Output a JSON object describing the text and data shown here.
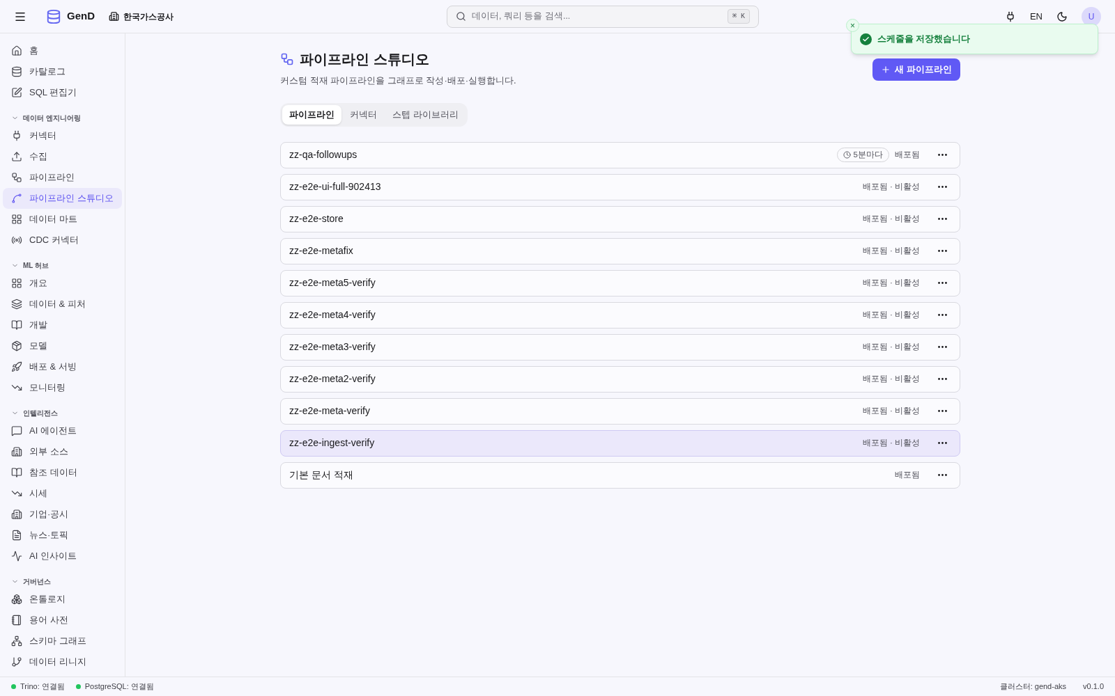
{
  "header": {
    "brand": "GenD",
    "org": "한국가스공사",
    "search": {
      "placeholder": "데이터, 쿼리 등을 검색...",
      "shortcut": "⌘ K"
    },
    "language": "EN",
    "avatar": "U"
  },
  "toast": {
    "message": "스케줄을 저장했습니다",
    "close": "×"
  },
  "sidebar": {
    "top_items": [
      {
        "label": "홈",
        "selected": false
      },
      {
        "label": "카탈로그",
        "selected": false
      },
      {
        "label": "SQL 편집기",
        "selected": false
      }
    ],
    "sections": [
      {
        "title": "데이터 엔지니어링",
        "expanded": true,
        "items": [
          {
            "label": "커넥터",
            "selected": false
          },
          {
            "label": "수집",
            "selected": false
          },
          {
            "label": "파이프라인",
            "selected": false
          },
          {
            "label": "파이프라인 스튜디오",
            "selected": true
          },
          {
            "label": "데이터 마트",
            "selected": false
          },
          {
            "label": "CDC 커넥터",
            "selected": false
          }
        ]
      },
      {
        "title": "ML 허브",
        "expanded": true,
        "items": [
          {
            "label": "개요",
            "selected": false
          },
          {
            "label": "데이터 & 피처",
            "selected": false
          },
          {
            "label": "개발",
            "selected": false
          },
          {
            "label": "모델",
            "selected": false
          },
          {
            "label": "배포 & 서빙",
            "selected": false
          },
          {
            "label": "모니터링",
            "selected": false
          }
        ]
      },
      {
        "title": "인텔리전스",
        "expanded": true,
        "items": [
          {
            "label": "AI 에이전트",
            "selected": false
          },
          {
            "label": "외부 소스",
            "selected": false
          },
          {
            "label": "참조 데이터",
            "selected": false
          },
          {
            "label": "시세",
            "selected": false
          },
          {
            "label": "기업·공시",
            "selected": false
          },
          {
            "label": "뉴스·토픽",
            "selected": false
          },
          {
            "label": "AI 인사이트",
            "selected": false
          }
        ]
      },
      {
        "title": "거버넌스",
        "expanded": true,
        "items": [
          {
            "label": "온톨로지",
            "selected": false
          },
          {
            "label": "용어 사전",
            "selected": false
          },
          {
            "label": "스키마 그래프",
            "selected": false
          },
          {
            "label": "데이터 리니지",
            "selected": false
          }
        ]
      }
    ]
  },
  "page": {
    "title": "파이프라인 스튜디오",
    "subtitle": "커스텀 적재 파이프라인을 그래프로 작성·배포·실행합니다.",
    "new_button": "새 파이프라인",
    "tabs": [
      {
        "label": "파이프라인",
        "selected": true
      },
      {
        "label": "커넥터",
        "selected": false
      },
      {
        "label": "스텝 라이브러리",
        "selected": false
      }
    ],
    "pipelines": [
      {
        "name": "zz-qa-followups",
        "schedule": "5분마다",
        "status": "배포됨",
        "highlighted": false
      },
      {
        "name": "zz-e2e-ui-full-902413",
        "status": "배포됨 · 비활성",
        "highlighted": false
      },
      {
        "name": "zz-e2e-store",
        "status": "배포됨 · 비활성",
        "highlighted": false
      },
      {
        "name": "zz-e2e-metafix",
        "status": "배포됨 · 비활성",
        "highlighted": false
      },
      {
        "name": "zz-e2e-meta5-verify",
        "status": "배포됨 · 비활성",
        "highlighted": false
      },
      {
        "name": "zz-e2e-meta4-verify",
        "status": "배포됨 · 비활성",
        "highlighted": false
      },
      {
        "name": "zz-e2e-meta3-verify",
        "status": "배포됨 · 비활성",
        "highlighted": false
      },
      {
        "name": "zz-e2e-meta2-verify",
        "status": "배포됨 · 비활성",
        "highlighted": false
      },
      {
        "name": "zz-e2e-meta-verify",
        "status": "배포됨 · 비활성",
        "highlighted": false
      },
      {
        "name": "zz-e2e-ingest-verify",
        "status": "배포됨 · 비활성",
        "highlighted": true
      },
      {
        "name": "기본 문서 적재",
        "status": "배포됨",
        "highlighted": false
      }
    ]
  },
  "status_bar": {
    "connections": [
      {
        "label": "Trino: 연결됨",
        "color": "#22c55e"
      },
      {
        "label": "PostgreSQL: 연결됨",
        "color": "#22c55e"
      }
    ],
    "cluster": "클러스터: gend-aks",
    "version": "v0.1.0"
  }
}
